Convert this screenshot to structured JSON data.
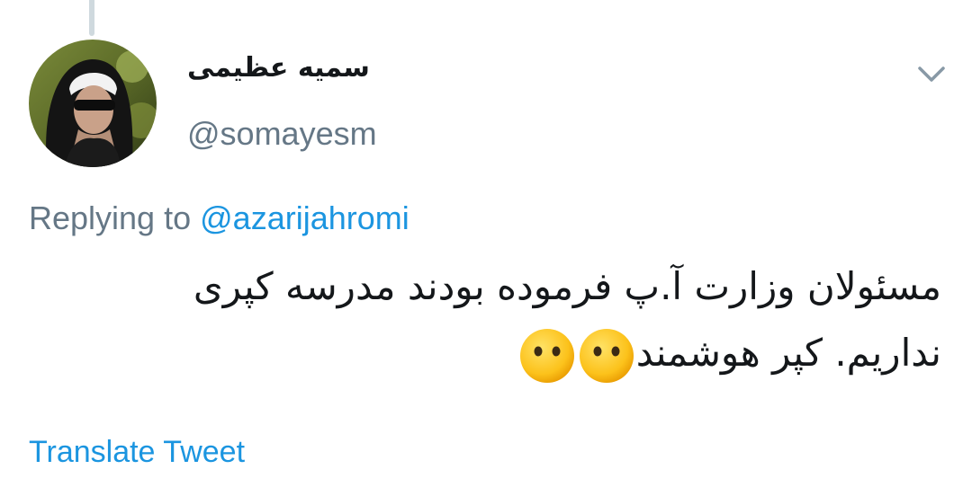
{
  "author": {
    "display_name": "سمیه عظیمی",
    "handle": "@somayesm",
    "avatar_icon": "user-avatar-photo"
  },
  "reply": {
    "prefix": "Replying to",
    "mention": "@azarijahromi"
  },
  "tweet": {
    "line1": "مسئولان وزارت آ.پ فرموده بودند مدرسه کپری",
    "line2_text": "نداریم. کپر هوشمند",
    "emoji_icon": "face-without-mouth-emoji",
    "emoji_count": 2
  },
  "actions": {
    "menu_icon": "chevron-down-icon",
    "translate_label": "Translate Tweet"
  },
  "colors": {
    "primary_text": "#14171a",
    "secondary_text": "#657786",
    "link": "#1b95e0",
    "thread_line": "#cfd9de",
    "background": "#ffffff"
  }
}
